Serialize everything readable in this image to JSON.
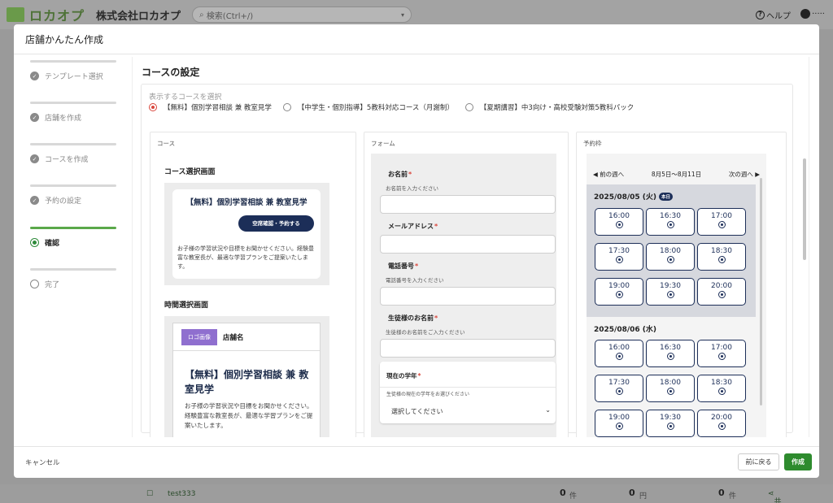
{
  "app": {
    "logo_text": "ロカオプ",
    "company": "株式会社ロカオプ",
    "search_placeholder": "検索(Ctrl+/)",
    "help_label": "ヘルプ",
    "user_label": "·····"
  },
  "bg_row": {
    "name": "test333",
    "c1": "0",
    "u1": "件",
    "c2": "0",
    "u2": "円",
    "c3": "0",
    "u3": "件",
    "share": "共有"
  },
  "modal": {
    "title": "店舗かんたん作成",
    "cancel": "キャンセル",
    "back": "前に戻る",
    "create": "作成"
  },
  "steps": [
    {
      "label": "テンプレート選択",
      "state": "done"
    },
    {
      "label": "店舗を作成",
      "state": "done"
    },
    {
      "label": "コースを作成",
      "state": "done"
    },
    {
      "label": "予約の設定",
      "state": "done"
    },
    {
      "label": "確認",
      "state": "current"
    },
    {
      "label": "完了",
      "state": "todo"
    }
  ],
  "content": {
    "title": "コースの設定",
    "select_label": "表示するコースを選択",
    "options": [
      "【無料】個別学習相談 兼 教室見学",
      "【中学生・個別指導】5教科対応コース（月謝制）",
      "【夏期講習】中3向け・高校受験対策5教科パック"
    ],
    "selected_option": 0
  },
  "course_col": {
    "label": "コース",
    "select_screen": "コース選択画面",
    "card_title": "【無料】個別学習相談 兼 教室見学",
    "card_button": "空席確認・予約する",
    "card_desc": "お子様の学習状況や目標をお聞かせください。経験豊富な教室長が、最適な学習プランをご提案いたします。",
    "time_screen": "時間選択画面",
    "logo_placeholder": "ロゴ画像",
    "shop_name": "店舗名",
    "detail_title": "【無料】個別学習相談 兼 教室見学",
    "detail_desc": "お子様の学習状況や目標をお聞かせください。経験豊富な教室長が、最適な学習プランをご提案いたします。"
  },
  "form_col": {
    "label": "フォーム",
    "name_label": "お名前",
    "name_hint": "お名前を入力ください",
    "email_label": "メールアドレス",
    "phone_label": "電話番号",
    "phone_hint": "電話番号を入力ください",
    "student_label": "生徒様のお名前",
    "student_hint": "生徒様のお名前をご入力ください",
    "grade_label": "現在の学年",
    "grade_hint": "生徒様の現在の学年をお選びください",
    "grade_select": "選択してください",
    "required_mark": "*"
  },
  "slots_col": {
    "label": "予約枠",
    "prev_week": "◀ 前の週へ",
    "range": "8月5日〜8月11日",
    "next_week": "次の週へ ▶",
    "today_badge": "本日",
    "days": [
      {
        "date": "2025/08/05 (火)",
        "times": [
          "16:00",
          "16:30",
          "17:00",
          "17:30",
          "18:00",
          "18:30",
          "19:00",
          "19:30",
          "20:00"
        ]
      },
      {
        "date": "2025/08/06 (水)",
        "times": [
          "16:00",
          "16:30",
          "17:00",
          "17:30",
          "18:00",
          "18:30",
          "19:00",
          "19:30",
          "20:00"
        ]
      }
    ]
  }
}
